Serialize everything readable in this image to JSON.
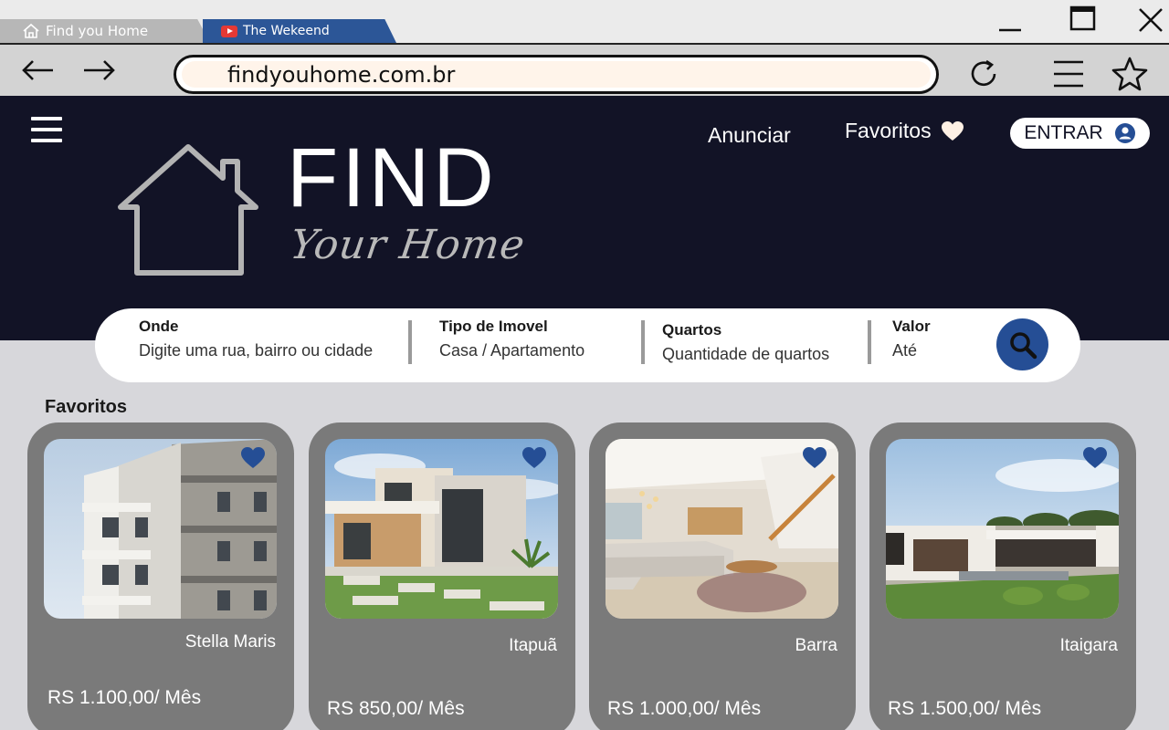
{
  "browser": {
    "tabs": [
      {
        "label": "Find you Home",
        "icon": "home-icon"
      },
      {
        "label": "The Wekeend",
        "icon": "youtube-icon"
      }
    ],
    "url": "findyouhome.com.br"
  },
  "header": {
    "logo_title": "FIND",
    "logo_subtitle": "Your Home",
    "nav": {
      "anunciar": "Anunciar",
      "favoritos": "Favoritos",
      "entrar": "ENTRAR"
    }
  },
  "search": {
    "fields": [
      {
        "label": "Onde",
        "placeholder": "Digite uma rua, bairro ou cidade"
      },
      {
        "label": "Tipo de Imovel",
        "placeholder": "Casa / Apartamento"
      },
      {
        "label": "Quartos",
        "placeholder": "Quantidade de quartos"
      },
      {
        "label": "Valor",
        "placeholder": "Até"
      }
    ]
  },
  "favorites": {
    "title": "Favoritos",
    "items": [
      {
        "location": "Stella Maris",
        "price": "RS 1.100,00/ Mês"
      },
      {
        "location": "Itapuã",
        "price": "RS 850,00/ Mês"
      },
      {
        "location": "Barra",
        "price": "RS 1.000,00/ Mês"
      },
      {
        "location": "Itaigara",
        "price": "RS 1.500,00/ Mês"
      }
    ]
  },
  "colors": {
    "header_bg": "#121326",
    "accent_blue": "#254e95",
    "card_bg": "#7a7a7a",
    "page_bg": "#d7d7db"
  }
}
